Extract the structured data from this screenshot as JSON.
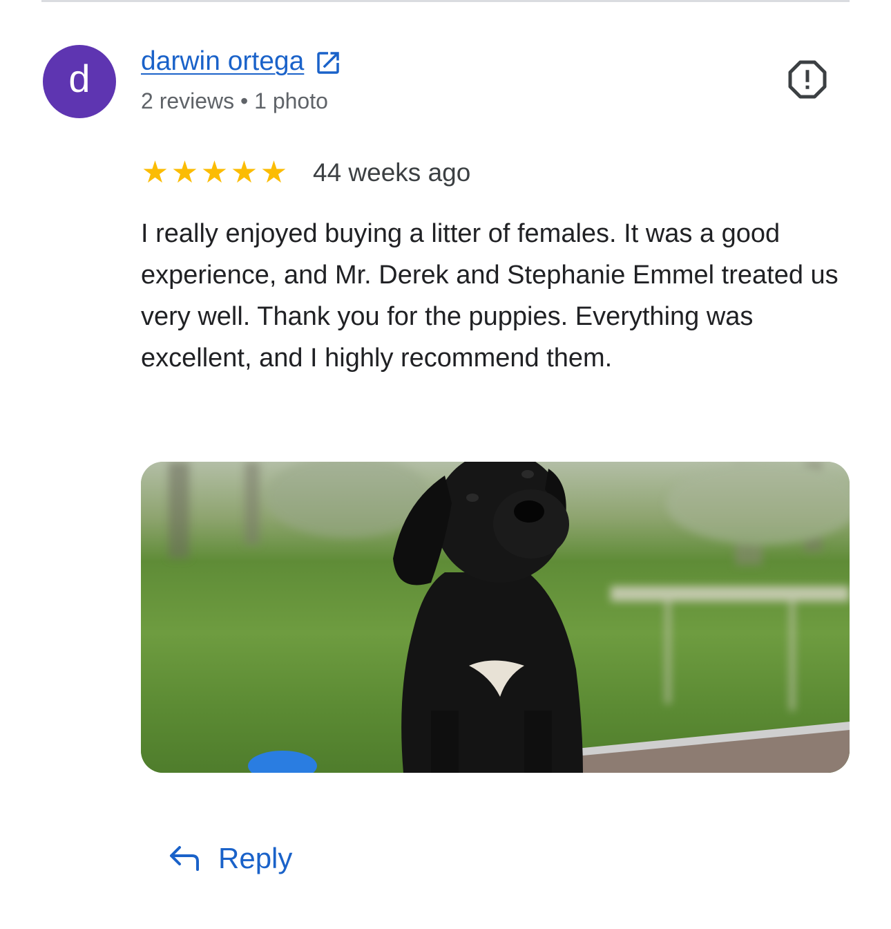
{
  "review": {
    "author": {
      "initial": "d",
      "name": "darwin ortega",
      "meta": "2 reviews • 1 photo",
      "avatar_color": "#5e35b1",
      "link_icon": "external-link-icon"
    },
    "rating": {
      "stars": 5,
      "max": 5,
      "star_color": "#fbbc04",
      "time_ago": "44 weeks ago"
    },
    "text": "I really enjoyed buying a litter of females. It was a good experience, and Mr. Derek and Stephanie Emmel treated us very well. Thank you for the puppies. Everything was excellent, and I highly recommend them.",
    "report_icon": "report-flag-icon",
    "photo": {
      "subject": "black puppy sitting on grass"
    },
    "reply": {
      "label": "Reply",
      "icon": "reply-arrow-icon"
    }
  },
  "colors": {
    "link": "#1a62c9",
    "secondary_text": "#5f6368",
    "divider": "#dadce0"
  }
}
